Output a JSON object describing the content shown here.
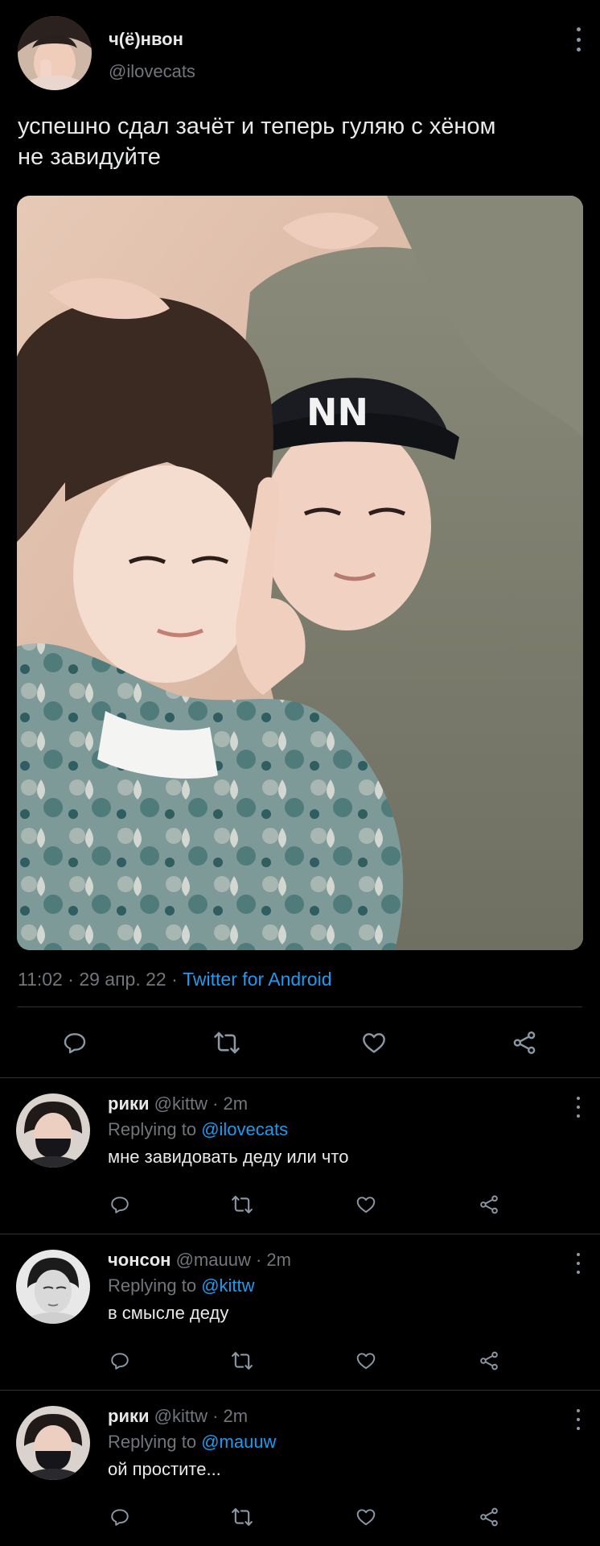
{
  "tweet": {
    "author_name": "ч(ё)нвон",
    "author_handle": "@ilovecats",
    "text_line1": "успешно сдал зачёт и теперь гуляю с хёном",
    "text_line2": "не завидуйте",
    "time": "11:02",
    "dot1": " · ",
    "date": "29 апр. 22",
    "dot2": " · ",
    "source": "Twitter for Android"
  },
  "actions": [
    "reply-icon",
    "retweet-icon",
    "like-icon",
    "share-icon"
  ],
  "replies": [
    {
      "name": "рики",
      "handle": "@kittw",
      "time": " · 2m",
      "replying_prefix": "Replying to ",
      "replying_to": "@ilovecats",
      "text": "мне завидовать деду или что"
    },
    {
      "name": "чонсон",
      "handle": "@mauuw",
      "time": " · 2m",
      "replying_prefix": "Replying to ",
      "replying_to": "@kittw",
      "text": "в смысле деду"
    },
    {
      "name": "рики",
      "handle": "@kittw",
      "time": " · 2m",
      "replying_prefix": "Replying to ",
      "replying_to": "@mauuw",
      "text": "ой простите..."
    }
  ],
  "colors": {
    "background": "#000000",
    "text": "#e7e9ea",
    "muted": "#71767b",
    "link": "#1d9bf0",
    "divider": "#2f3336"
  }
}
